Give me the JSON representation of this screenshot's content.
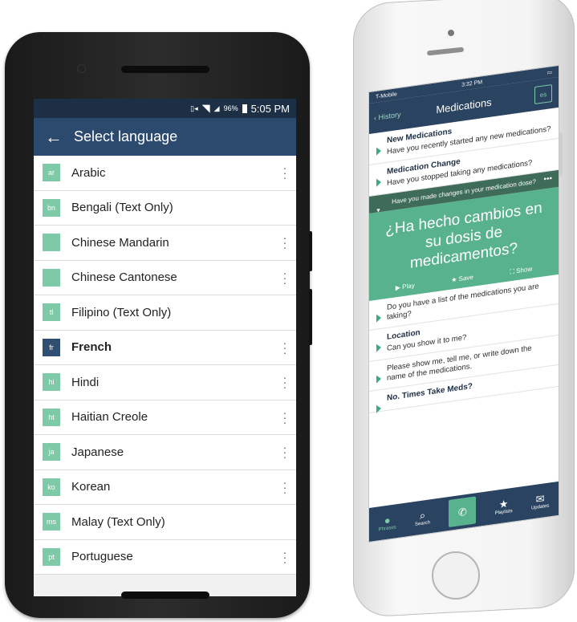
{
  "android": {
    "status": {
      "signal": "96%",
      "time": "5:05 PM"
    },
    "toolbar": {
      "back_icon": "←",
      "title": "Select language"
    },
    "languages": [
      {
        "code": "ar",
        "name": "Arabic",
        "menu": true,
        "selected": false
      },
      {
        "code": "bn",
        "name": "Bengali (Text Only)",
        "menu": false,
        "selected": false
      },
      {
        "code": "",
        "name": "Chinese Mandarin",
        "menu": true,
        "selected": false
      },
      {
        "code": "",
        "name": "Chinese Cantonese",
        "menu": true,
        "selected": false
      },
      {
        "code": "tl",
        "name": "Filipino (Text Only)",
        "menu": false,
        "selected": false
      },
      {
        "code": "fr",
        "name": "French",
        "menu": true,
        "selected": true
      },
      {
        "code": "hi",
        "name": "Hindi",
        "menu": true,
        "selected": false
      },
      {
        "code": "ht",
        "name": "Haitian Creole",
        "menu": true,
        "selected": false
      },
      {
        "code": "ja",
        "name": "Japanese",
        "menu": true,
        "selected": false
      },
      {
        "code": "ko",
        "name": "Korean",
        "menu": true,
        "selected": false
      },
      {
        "code": "ms",
        "name": "Malay (Text Only)",
        "menu": false,
        "selected": false
      },
      {
        "code": "pt",
        "name": "Portuguese",
        "menu": true,
        "selected": false
      }
    ],
    "colors": {
      "toolbar": "#2b4a6e",
      "code_badge": "#7ec9a8",
      "selected_badge": "#2f4f72"
    }
  },
  "iphone": {
    "status": {
      "carrier": "T-Mobile",
      "time": "3:32 PM"
    },
    "nav": {
      "back_label": "History",
      "title": "Medications",
      "lang_badge": "es"
    },
    "cards_top": [
      {
        "heading": "New Medications",
        "text": "Have you recently started any new medications?"
      },
      {
        "heading": "Medication Change",
        "text": "Have you stopped taking any medications?"
      }
    ],
    "selected_prompt": "Have you made changes in your medication dose?",
    "translation": "¿Ha hecho cambios en su dosis de medicamentos?",
    "actions": {
      "play": "Play",
      "save": "Save",
      "show": "Show"
    },
    "cards_bottom": [
      {
        "heading": "",
        "text": "Do you have a list of the medications you are taking?"
      },
      {
        "heading": "Location",
        "text": "Can you show it to me?"
      },
      {
        "heading": "",
        "text": "Please show me, tell me, or write down the name of the medications."
      },
      {
        "heading": "No. Times Take Meds?",
        "text": ""
      }
    ],
    "tabs": [
      {
        "label": "Phrases",
        "icon": "speech-bubble-icon"
      },
      {
        "label": "Search",
        "icon": "search-icon"
      },
      {
        "label": "",
        "icon": "phone-icon"
      },
      {
        "label": "Playlists",
        "icon": "star-icon"
      },
      {
        "label": "Updates",
        "icon": "mail-icon"
      }
    ],
    "colors": {
      "nav": "#2a4361",
      "accent": "#58b28d",
      "band": "#3f6b59"
    }
  }
}
